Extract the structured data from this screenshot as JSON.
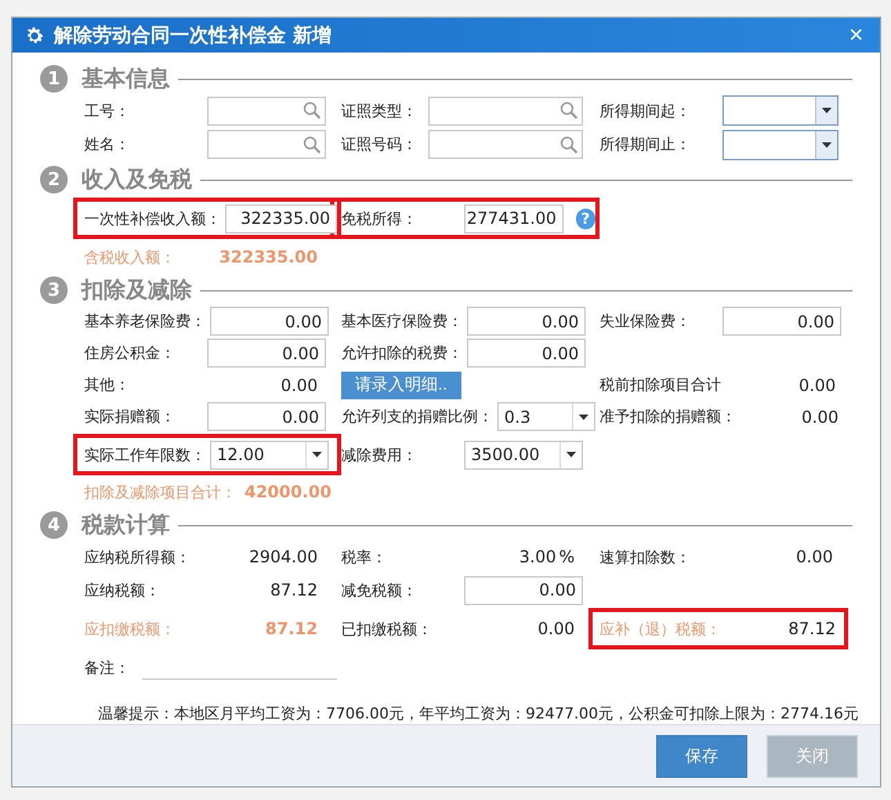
{
  "window": {
    "title": "解除劳动合同一次性补偿金 新增",
    "close": "×"
  },
  "sections": [
    {
      "number": "1",
      "title": "基本信息",
      "rows": [
        [
          {
            "kind": "lookup",
            "label": "工号："
          },
          {
            "kind": "lookup",
            "label": "证照类型："
          },
          {
            "kind": "dropdown",
            "label": "所得期间起："
          }
        ],
        [
          {
            "kind": "lookup",
            "label": "姓名："
          },
          {
            "kind": "lookup",
            "label": "证照号码："
          },
          {
            "kind": "dropdown",
            "label": "所得期间止："
          }
        ]
      ]
    },
    {
      "number": "2",
      "title": "收入及免税",
      "rows": [
        [
          {
            "kind": "input",
            "label": "一次性补偿收入额：",
            "value": "322335.00",
            "highlighted": true
          },
          {
            "kind": "input",
            "label": "免税所得：",
            "value": "277431.00",
            "highlighted": true,
            "help": "?"
          }
        ],
        [
          {
            "kind": "static",
            "label": "含税收入额：",
            "value": "322335.00",
            "label_accent": true,
            "value_accent": true
          }
        ]
      ]
    },
    {
      "number": "3",
      "title": "扣除及减除",
      "rows": [
        [
          {
            "kind": "input",
            "label": "基本养老保险费：",
            "value": "0.00"
          },
          {
            "kind": "input",
            "label": "基本医疗保险费：",
            "value": "0.00"
          },
          {
            "kind": "input",
            "label": "失业保险费：",
            "value": "0.00"
          }
        ],
        [
          {
            "kind": "input",
            "label": "住房公积金：",
            "value": "0.00"
          },
          {
            "kind": "input",
            "label": "允许扣除的税费：",
            "value": "0.00"
          }
        ],
        [
          {
            "kind": "static",
            "label": "其他：",
            "value": "0.00"
          },
          {
            "kind": "button",
            "label": "请录入明细.."
          },
          {
            "kind": "static",
            "label": "税前扣除项目合计",
            "value": "0.00"
          }
        ],
        [
          {
            "kind": "input",
            "label": "实际捐赠额：",
            "value": "0.00"
          },
          {
            "kind": "select",
            "label": "允许列支的捐赠比例：",
            "value": "0.3"
          },
          {
            "kind": "static",
            "label": "准予扣除的捐赠额：",
            "value": "0.00"
          }
        ],
        [
          {
            "kind": "select",
            "label": "实际工作年限数：",
            "value": "12.00",
            "highlighted": true
          },
          {
            "kind": "select",
            "label": "减除费用：",
            "value": "3500.00"
          }
        ],
        [
          {
            "kind": "static",
            "label": "扣除及减除项目合计：",
            "value": "42000.00",
            "label_accent": true,
            "value_accent": true
          }
        ]
      ]
    },
    {
      "number": "4",
      "title": "税款计算",
      "rows": [
        [
          {
            "kind": "static",
            "label": "应纳税所得额：",
            "value": "2904.00"
          },
          {
            "kind": "static",
            "label": "税率：",
            "value": "3.00",
            "unit": "%"
          },
          {
            "kind": "static",
            "label": "速算扣除数：",
            "value": "0.00"
          }
        ],
        [
          {
            "kind": "static",
            "label": "应纳税额：",
            "value": "87.12"
          },
          {
            "kind": "input",
            "label": "减免税额：",
            "value": "0.00"
          }
        ],
        [
          {
            "kind": "static",
            "label": "应扣缴税额：",
            "value": "87.12",
            "label_accent": true,
            "value_accent": true
          },
          {
            "kind": "static",
            "label": "已扣缴税额：",
            "value": "0.00"
          },
          {
            "kind": "static",
            "label": "应补（退）税额：",
            "value": "87.12",
            "label_accent": true,
            "highlighted": true
          }
        ],
        [
          {
            "kind": "remark",
            "label": "备注："
          }
        ]
      ]
    }
  ],
  "tip": "温馨提示：本地区月平均工资为：7706.00元，年平均工资为：92477.00元，公积金可扣除上限为：2774.16元",
  "buttons": [
    {
      "label": "保存",
      "disabled": false
    },
    {
      "label": "关闭",
      "disabled": true
    }
  ]
}
